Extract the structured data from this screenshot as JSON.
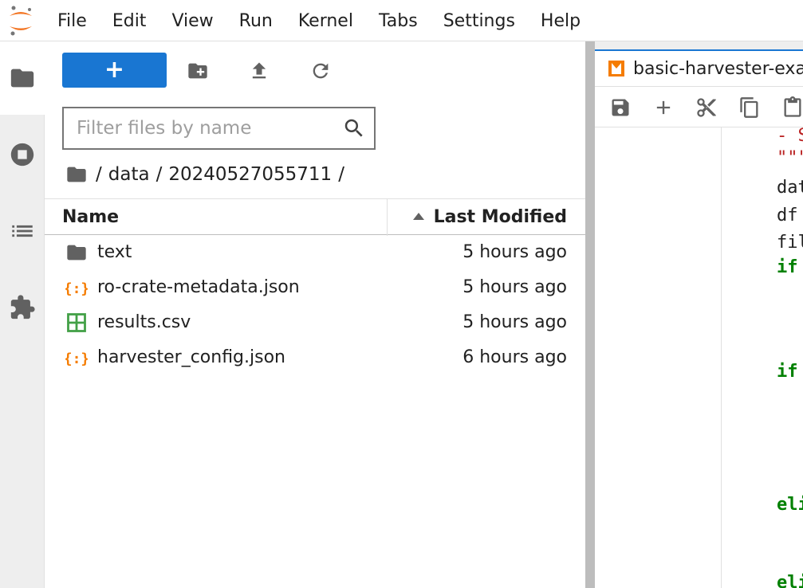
{
  "menu": [
    "File",
    "Edit",
    "View",
    "Run",
    "Kernel",
    "Tabs",
    "Settings",
    "Help"
  ],
  "filebrowser": {
    "new_button_label": "+",
    "filter_placeholder": "Filter files by name",
    "breadcrumb": [
      "/",
      "data",
      "/",
      "20240527055711",
      "/"
    ],
    "columns": {
      "name": "Name",
      "modified": "Last Modified"
    },
    "files": [
      {
        "name": "text",
        "modified": "5 hours ago",
        "icon": "folder-icon"
      },
      {
        "name": "ro-crate-metadata.json",
        "modified": "5 hours ago",
        "icon": "json-icon"
      },
      {
        "name": "results.csv",
        "modified": "5 hours ago",
        "icon": "spreadsheet-icon"
      },
      {
        "name": "harvester_config.json",
        "modified": "6 hours ago",
        "icon": "json-icon"
      }
    ]
  },
  "notebook": {
    "tab_title": "basic-harvester-exar",
    "code_lines": [
      {
        "text": "- S",
        "cls": "str"
      },
      {
        "text": "\"\"\"",
        "cls": "str"
      },
      {
        "text": "dat",
        "cls": "plain"
      },
      {
        "text": "df",
        "cls": "plain"
      },
      {
        "text": "fil",
        "cls": "plain"
      },
      {
        "text": "if",
        "cls": "kw"
      },
      {
        "text": "if",
        "cls": "kw"
      },
      {
        "text": "eli",
        "cls": "kw"
      },
      {
        "text": "eli",
        "cls": "kw"
      }
    ]
  },
  "colors": {
    "accent": "#1976d2",
    "json_icon": "#f57c00",
    "csv_icon": "#43a047",
    "keyword": "#008000",
    "string": "#ba2121"
  }
}
